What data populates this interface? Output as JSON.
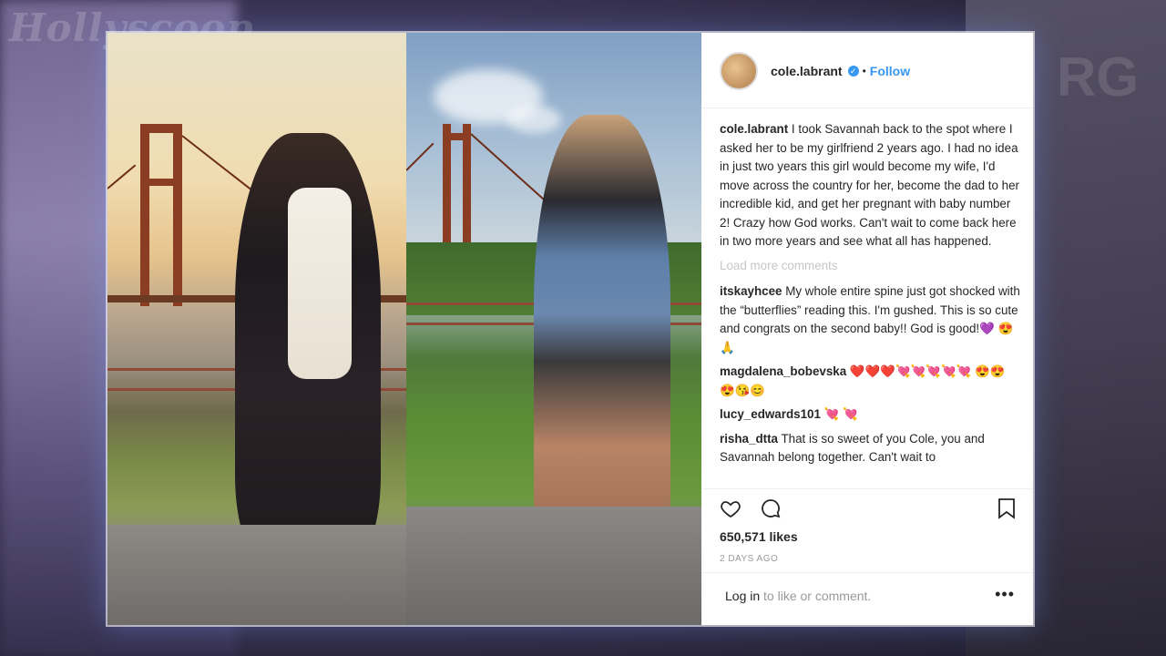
{
  "watermark": "Hollyscoop",
  "background_text": "RG",
  "post": {
    "username": "cole.labrant",
    "verified": true,
    "follow_label": "Follow",
    "separator": "•",
    "caption_user": "cole.labrant",
    "caption": "I took Savannah back to the spot where I asked her to be my girlfriend 2 years ago. I had no idea in just two years this girl would become my wife, I'd move across the country for her, become the dad to her incredible kid, and get her pregnant with baby number 2! Crazy how God works. Can't wait to come back here in two more years and see what all has happened.",
    "load_more": "Load more comments",
    "comments": [
      {
        "user": "itskayhcee",
        "text": "My whole entire spine just got shocked with the “butterflies” reading this. I'm gushed. This is so cute and congrats on the second baby!! God is good!💜 😍 🙏"
      },
      {
        "user": "magdalena_bobevska",
        "text": "❤️❤️❤️💘💘💘💘💘 😍😍😍😘😊"
      },
      {
        "user": "lucy_edwards101",
        "text": "💘 💘"
      },
      {
        "user": "risha_dtta",
        "text": "That is so sweet of you Cole, you and Savannah belong together. Can't wait to"
      }
    ],
    "likes": "650,571 likes",
    "time_ago": "2 DAYS AGO",
    "login_link": "Log in",
    "login_rest": " to like or comment.",
    "more_label": "•••"
  },
  "colors": {
    "follow": "#3897f0",
    "verified": "#3897f0",
    "text": "#262626",
    "muted": "#999999"
  }
}
